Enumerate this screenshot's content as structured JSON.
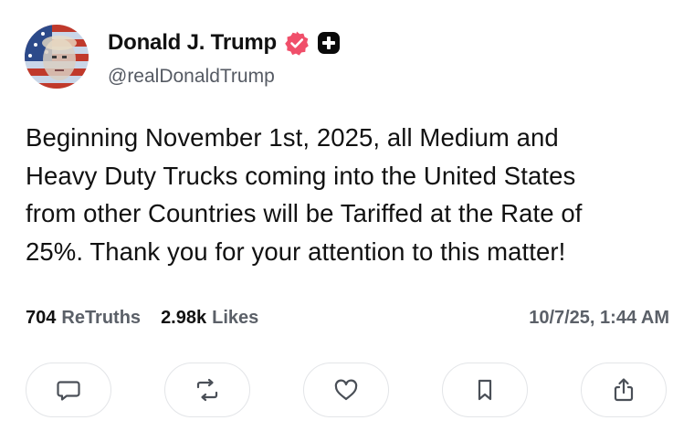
{
  "author": {
    "display_name": "Donald J. Trump",
    "handle": "@realDonaldTrump",
    "verified_icon": "verified-badge-icon",
    "membership_icon": "plus-badge-icon"
  },
  "post": {
    "lines": [
      "Beginning November 1st, 2025, all Medium and",
      "Heavy Duty Trucks coming into the United States",
      "from other Countries will be Tariffed at the Rate of",
      "25%. Thank you for your attention to this matter!"
    ]
  },
  "stats": {
    "retruths_count": "704",
    "retruths_label": "ReTruths",
    "likes_count": "2.98k",
    "likes_label": "Likes",
    "timestamp": "10/7/25, 1:44 AM"
  },
  "actions": [
    {
      "icon": "reply-icon"
    },
    {
      "icon": "retruth-icon"
    },
    {
      "icon": "like-icon"
    },
    {
      "icon": "bookmark-icon"
    },
    {
      "icon": "share-icon"
    }
  ],
  "colors": {
    "verified": "#f04f6a",
    "muted_text": "#5b6068",
    "border": "#e3e5e8"
  }
}
